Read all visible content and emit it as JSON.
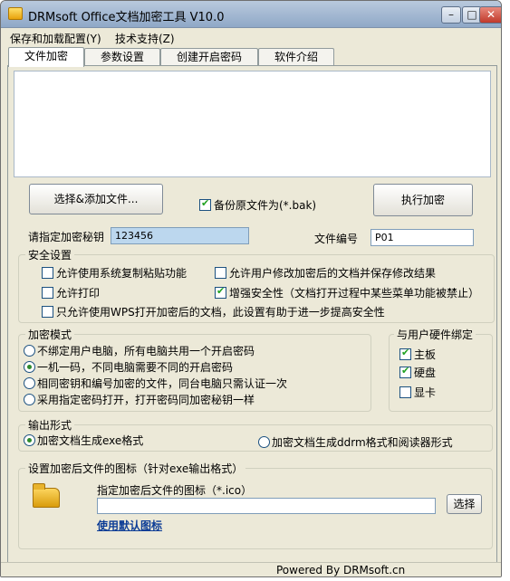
{
  "window": {
    "title": "DRMsoft Office文档加密工具 V10.0"
  },
  "menu": {
    "item1": "保存和加载配置(Y)",
    "item2": "技术支持(Z)"
  },
  "tabs": [
    "文件加密",
    "参数设置",
    "创建开启密码",
    "软件介绍"
  ],
  "top": {
    "select_button": "选择&添加文件...",
    "backup_label": "备份原文件为(*.bak)",
    "exec_button": "执行加密",
    "key_label": "请指定加密秘钥",
    "key_value": "123456",
    "fileno_label": "文件编号",
    "fileno_value": "P01"
  },
  "security": {
    "title": "安全设置",
    "opt1": "允许使用系统复制粘贴功能",
    "opt2": "允许用户修改加密后的文档并保存修改结果",
    "opt3": "允许打印",
    "opt4": "增强安全性（文档打开过程中某些菜单功能被禁止）",
    "opt5": "只允许使用WPS打开加密后的文档，此设置有助于进一步提高安全性"
  },
  "mode": {
    "title": "加密模式",
    "opt1": "不绑定用户电脑，所有电脑共用一个开启密码",
    "opt2": "一机一码，不同电脑需要不同的开启密码",
    "opt3": "相同密钥和编号加密的文件，同台电脑只需认证一次",
    "opt4": "采用指定密码打开，打开密码同加密秘钥一样"
  },
  "hardware": {
    "title": "与用户硬件绑定",
    "opt1": "主板",
    "opt2": "硬盘",
    "opt3": "显卡"
  },
  "output": {
    "title": "输出形式",
    "opt1": "加密文档生成exe格式",
    "opt2": "加密文档生成ddrm格式和阅读器形式"
  },
  "icon_section": {
    "title": "设置加密后文件的图标（针对exe输出格式）",
    "field_label": "指定加密后文件的图标（*.ico）",
    "field_value": "",
    "browse_button": "选择",
    "default_link": "使用默认图标"
  },
  "status": {
    "text": "Powered By DRMsoft.cn"
  }
}
